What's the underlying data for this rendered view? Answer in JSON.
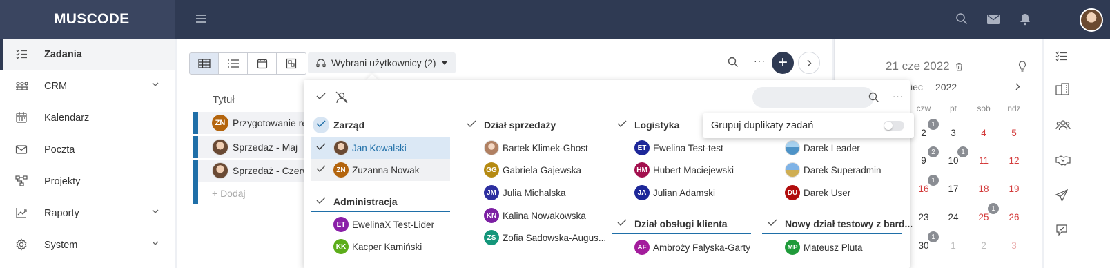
{
  "app": {
    "brand": "MUSCODE"
  },
  "sidebar": {
    "items": [
      {
        "label": "Zadania",
        "icon": "tasks-list-icon",
        "active": true
      },
      {
        "label": "CRM",
        "icon": "crm-people-icon",
        "expandable": true
      },
      {
        "label": "Kalendarz",
        "icon": "calendar-icon"
      },
      {
        "label": "Poczta",
        "icon": "mail-icon"
      },
      {
        "label": "Projekty",
        "icon": "projects-icon"
      },
      {
        "label": "Raporty",
        "icon": "reports-chart-icon",
        "expandable": true
      },
      {
        "label": "System",
        "icon": "gear-icon",
        "expandable": true
      }
    ]
  },
  "toolbar": {
    "user_filter_label": "Wybrani użytkownicy (2)",
    "add_label": "+"
  },
  "tasks": {
    "column_title": "Tytuł",
    "rows": [
      {
        "title": "Przygotowanie re",
        "avatar": "ZN",
        "avatar_color": "#b4650e"
      },
      {
        "title": "Sprzedaż - Maj",
        "avatar": "photo"
      },
      {
        "title": "Sprzedaż - Czerw",
        "avatar": "photo"
      }
    ],
    "add_label": "+ Dodaj",
    "accent_color": "#1f6fa8"
  },
  "calendar": {
    "date": "21 cze 2022",
    "month_fragment": "iec",
    "year": "2022",
    "day_headers": [
      "czw",
      "pt",
      "sob",
      "ndz"
    ],
    "weeks": [
      [
        "2",
        "3",
        "4",
        "5"
      ],
      [
        "9",
        "10",
        "11",
        "12"
      ],
      [
        "16",
        "17",
        "18",
        "19"
      ],
      [
        "23",
        "24",
        "25",
        "26"
      ],
      [
        "30",
        "1",
        "2",
        "3"
      ]
    ],
    "badges": [
      "1",
      "2",
      "1",
      "1",
      "1",
      "1"
    ]
  },
  "user_panel": {
    "groups": [
      {
        "name": "Zarząd",
        "users": [
          {
            "name": "Jan Kowalski",
            "initials": "",
            "color": "",
            "selected": true
          },
          {
            "name": "Zuzanna Nowak",
            "initials": "ZN",
            "color": "#b4650e",
            "selected": true
          }
        ]
      },
      {
        "name": "Administracja",
        "users": [
          {
            "name": "EwelinaX Test-Lider",
            "initials": "ET",
            "color": "#8a1fa8"
          },
          {
            "name": "Kacper Kamiński",
            "initials": "KK",
            "color": "#5cad1a"
          }
        ]
      },
      {
        "name": "Dział sprzedaży",
        "users": [
          {
            "name": "Bartek Klimek-Ghost",
            "initials": "",
            "color": ""
          },
          {
            "name": "Gabriela Gajewska",
            "initials": "GG",
            "color": "#b58a12"
          },
          {
            "name": "Julia Michalska",
            "initials": "JM",
            "color": "#2d2fa0"
          },
          {
            "name": "Kalina Nowakowska",
            "initials": "KN",
            "color": "#7c1fa3"
          },
          {
            "name": "Zofia Sadowska-Augus...",
            "initials": "ZS",
            "color": "#14967a"
          }
        ]
      },
      {
        "name": "Logistyka",
        "users": [
          {
            "name": "Ewelina Test-test",
            "initials": "ET",
            "color": "#1d2799"
          },
          {
            "name": "Hubert Maciejewski",
            "initials": "HM",
            "color": "#a3104e"
          },
          {
            "name": "Julian Adamski",
            "initials": "JA",
            "color": "#1d2799"
          }
        ]
      },
      {
        "name": "Dział obsługi klienta",
        "users": [
          {
            "name": "Ambroży Falyska-Garty",
            "initials": "AF",
            "color": "#a31c9c"
          }
        ]
      },
      {
        "name": "",
        "users": [
          {
            "name": "Darek Leader",
            "initials": "",
            "color": ""
          },
          {
            "name": "Darek Superadmin",
            "initials": "",
            "color": ""
          },
          {
            "name": "Darek User",
            "initials": "DU",
            "color": "#b10d0d"
          }
        ]
      },
      {
        "name": "Nowy dział testowy z bard...",
        "users": [
          {
            "name": "Mateusz Pluta",
            "initials": "MP",
            "color": "#1f9a3a"
          }
        ]
      }
    ]
  },
  "tooltip": {
    "label": "Grupuj duplikaty zadań",
    "toggle_on": false
  }
}
